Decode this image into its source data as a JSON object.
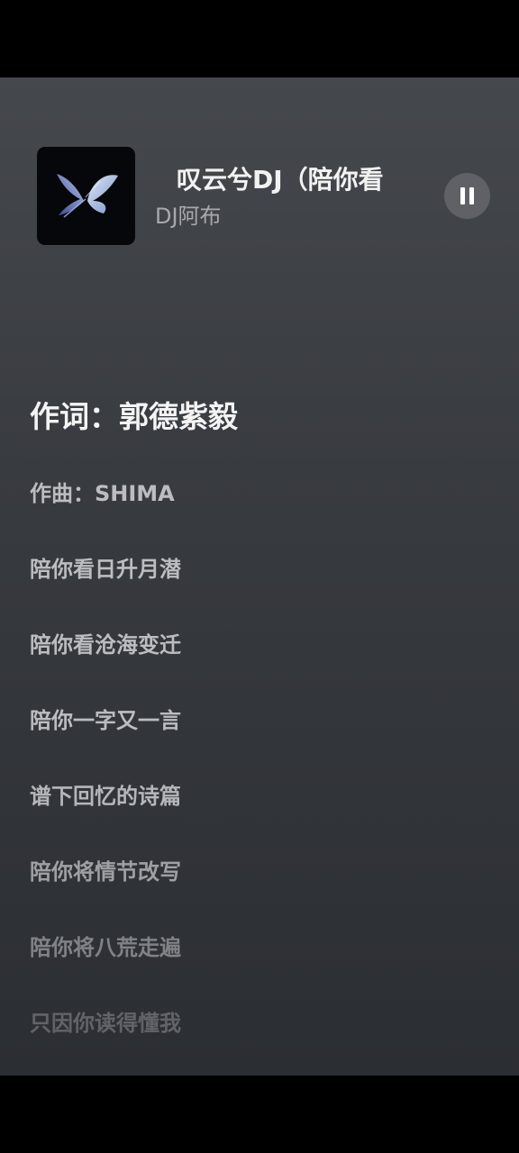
{
  "player": {
    "song_title": "叹云兮DJ（陪你看",
    "artist": "DJ阿布",
    "cover_icon": "butterfly-cover-art",
    "pause_icon": "pause-icon"
  },
  "lyrics": {
    "lines": [
      "作词：郭德紫毅",
      "作曲：SHIMA",
      "陪你看日升月潜",
      "陪你看沧海变迁",
      "陪你一字又一言",
      "谱下回忆的诗篇",
      "陪你将情节改写",
      "陪你将八荒走遍",
      "只因你读得懂我"
    ],
    "active_index": 0
  }
}
